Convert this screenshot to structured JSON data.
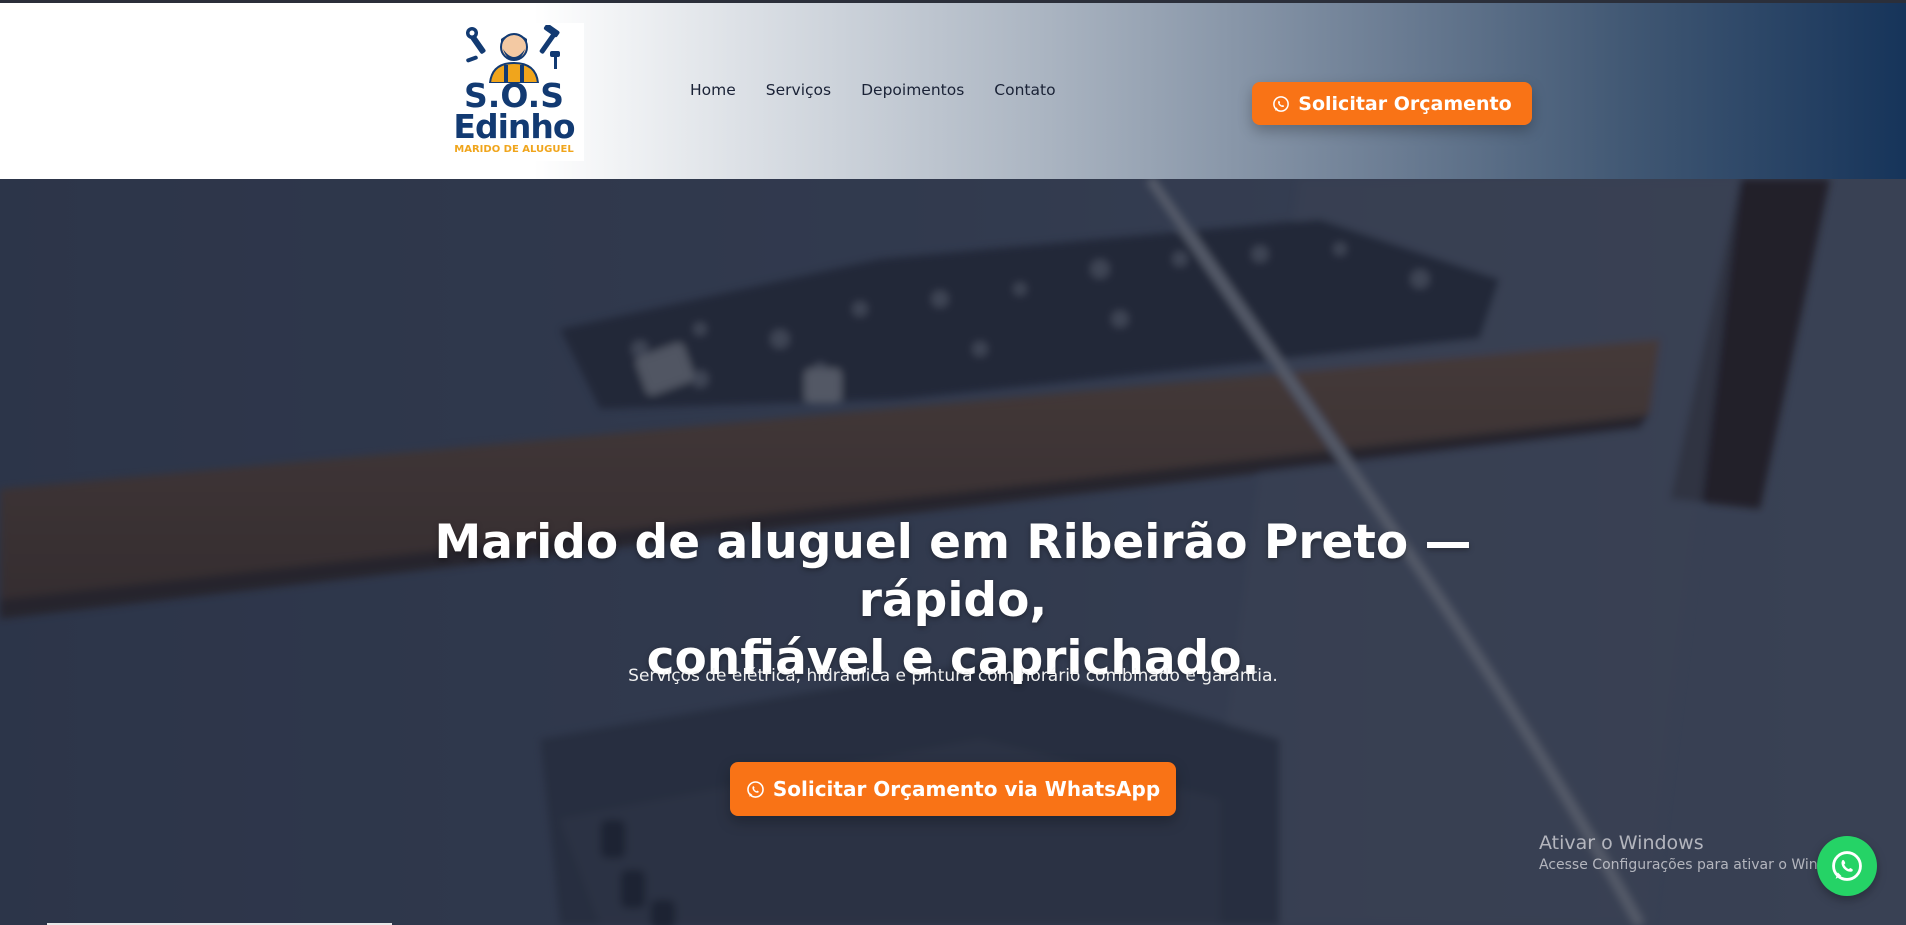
{
  "brand": {
    "logo_line1": "S.O.S",
    "logo_line2": "Edinho",
    "logo_line3": "MARIDO DE ALUGUEL",
    "primary_color": "#123a72",
    "accent_color": "#f0a51c"
  },
  "nav": {
    "items": [
      {
        "label": "Home"
      },
      {
        "label": "Serviços"
      },
      {
        "label": "Depoimentos"
      },
      {
        "label": "Contato"
      }
    ]
  },
  "header": {
    "cta_label": "Solicitar Orçamento",
    "cta_icon": "whatsapp-icon",
    "cta_color": "#f97316"
  },
  "hero": {
    "title_line1": "Marido de aluguel em Ribeirão Preto — rápido,",
    "title_line2": "confiável e caprichado.",
    "subtitle": "Serviços de elétrica, hidráulica e pintura com horário combinado e garantia.",
    "cta_label": "Solicitar Orçamento via WhatsApp",
    "cta_icon": "whatsapp-icon"
  },
  "windows_watermark": {
    "line1": "Ativar o Windows",
    "line2": "Acesse Configurações para ativar o Windo"
  },
  "floating_whatsapp": {
    "icon": "whatsapp-icon",
    "color": "#25d366"
  }
}
